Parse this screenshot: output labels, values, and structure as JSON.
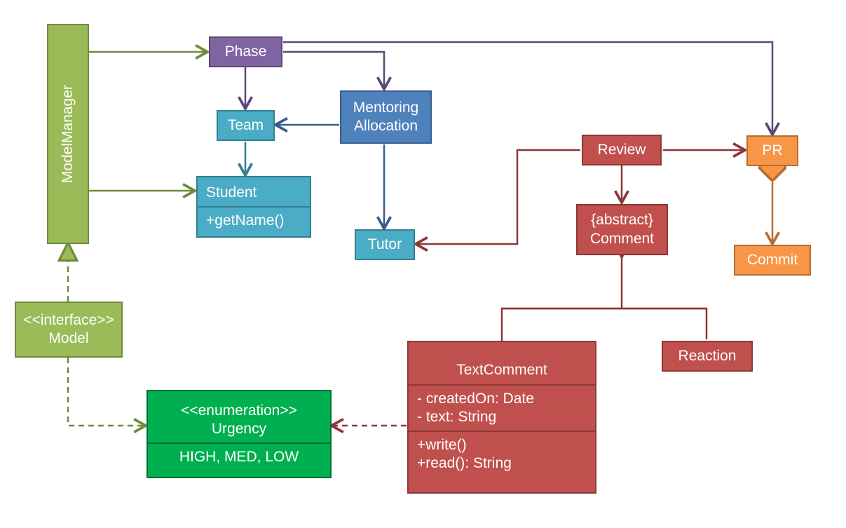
{
  "nodes": {
    "modelManager": {
      "label": "ModelManager"
    },
    "model": {
      "stereo": "<<interface>>",
      "name": "Model"
    },
    "urgency": {
      "stereo": "<<enumeration>>",
      "name": "Urgency",
      "values": "HIGH, MED, LOW"
    },
    "phase": {
      "label": "Phase"
    },
    "team": {
      "label": "Team"
    },
    "student": {
      "name": "Student",
      "method": "+getName()"
    },
    "mentoring": {
      "l1": "Mentoring",
      "l2": "Allocation"
    },
    "tutor": {
      "label": "Tutor"
    },
    "review": {
      "label": "Review"
    },
    "comment": {
      "l1": "{abstract}",
      "l2": "Comment"
    },
    "textComment": {
      "name": "TextComment",
      "attrs": "- createdOn: Date\n- text: String",
      "ops": "+write()\n+read(): String"
    },
    "reaction": {
      "label": "Reaction"
    },
    "pr": {
      "label": "PR"
    },
    "commit": {
      "label": "Commit"
    }
  },
  "colors": {
    "greenStroke": "#71893f",
    "greenFill": "#9bbb59",
    "green2Stroke": "#007236",
    "purpleStroke": "#5c4776",
    "purpleFill": "#8064a2",
    "tealStroke": "#357d91",
    "blueStroke": "#385d8a",
    "redStroke": "#8c3836",
    "redFill": "#c0504d",
    "orangeStroke": "#b66d31",
    "orangeFill": "#f79646"
  }
}
